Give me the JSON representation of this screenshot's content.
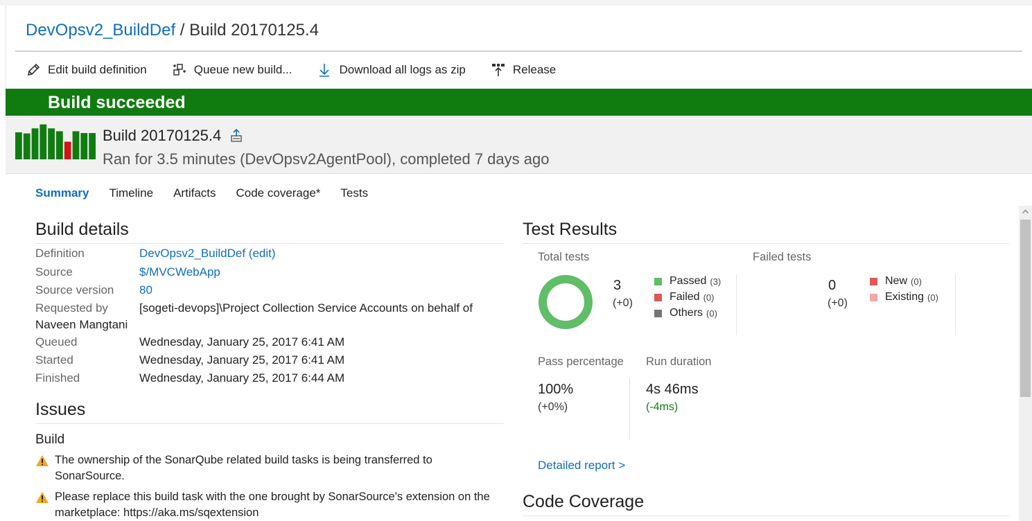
{
  "breadcrumb": {
    "definition": "DevOpsv2_BuildDef",
    "separator": "/",
    "build": "Build 20170125.4"
  },
  "toolbar": {
    "edit": "Edit build definition",
    "queue": "Queue new build...",
    "download": "Download all logs as zip",
    "release": "Release"
  },
  "banner": {
    "status": "Build succeeded",
    "color": "#107c10"
  },
  "build_header": {
    "title": "Build 20170125.4",
    "subtitle": "Ran for 3.5 minutes (DevOpsv2AgentPool), completed 7 days ago",
    "history_bars": [
      {
        "level": 0.75,
        "status": "succeeded"
      },
      {
        "level": 0.72,
        "status": "succeeded"
      },
      {
        "level": 0.86,
        "status": "succeeded"
      },
      {
        "level": 0.97,
        "status": "succeeded"
      },
      {
        "level": 0.86,
        "status": "succeeded"
      },
      {
        "level": 0.78,
        "status": "succeeded"
      },
      {
        "level": 0.49,
        "status": "failed"
      },
      {
        "level": 0.78,
        "status": "succeeded"
      },
      {
        "level": 0.73,
        "status": "succeeded"
      },
      {
        "level": 0.73,
        "status": "succeeded"
      }
    ]
  },
  "tabs": [
    "Summary",
    "Timeline",
    "Artifacts",
    "Code coverage*",
    "Tests"
  ],
  "active_tab": "Summary",
  "build_details": {
    "heading": "Build details",
    "definition_label": "Definition",
    "definition_value": "DevOpsv2_BuildDef (edit)",
    "source_label": "Source",
    "source_value": "$/MVCWebApp",
    "source_version_label": "Source version",
    "source_version_value": "80",
    "requested_by_label": "Requested by",
    "requested_by_value": "[sogeti-devops]\\Project Collection Service Accounts on behalf of",
    "requested_by_value_cont": "Naveen Mangtani",
    "queued_label": "Queued",
    "queued_value": "Wednesday, January 25, 2017 6:41 AM",
    "started_label": "Started",
    "started_value": "Wednesday, January 25, 2017 6:41 AM",
    "finished_label": "Finished",
    "finished_value": "Wednesday, January 25, 2017 6:44 AM"
  },
  "issues": {
    "heading": "Issues",
    "group": "Build",
    "items": [
      "The ownership of the SonarQube related build tasks is being transferred to SonarSource.",
      "Please replace this build task with the one brought by SonarSource's extension on the marketplace: https://aka.ms/sqextension"
    ]
  },
  "test_results": {
    "heading": "Test Results",
    "total_label": "Total tests",
    "total_value": "3",
    "total_delta": "(+0)",
    "passed_label": "Passed",
    "passed_count": "(3)",
    "failed_label": "Failed",
    "failed_count": "(0)",
    "others_label": "Others",
    "others_count": "(0)",
    "failed_tests_label": "Failed tests",
    "failed_tests_value": "0",
    "failed_tests_delta": "(+0)",
    "new_label": "New",
    "new_count": "(0)",
    "existing_label": "Existing",
    "existing_count": "(0)",
    "pass_pct_label": "Pass percentage",
    "pass_pct_value": "100%",
    "pass_pct_delta": "(+0%)",
    "duration_label": "Run duration",
    "duration_value": "4s 46ms",
    "duration_delta": "(-4ms)",
    "detailed_report": "Detailed report >",
    "pass_fraction": 1.0,
    "colors": {
      "passed": "#60bd68",
      "failed": "#e05757",
      "others": "#767676",
      "existing": "#f0a8a8",
      "delta_good": "#107c10"
    }
  },
  "code_coverage": {
    "heading": "Code Coverage"
  }
}
